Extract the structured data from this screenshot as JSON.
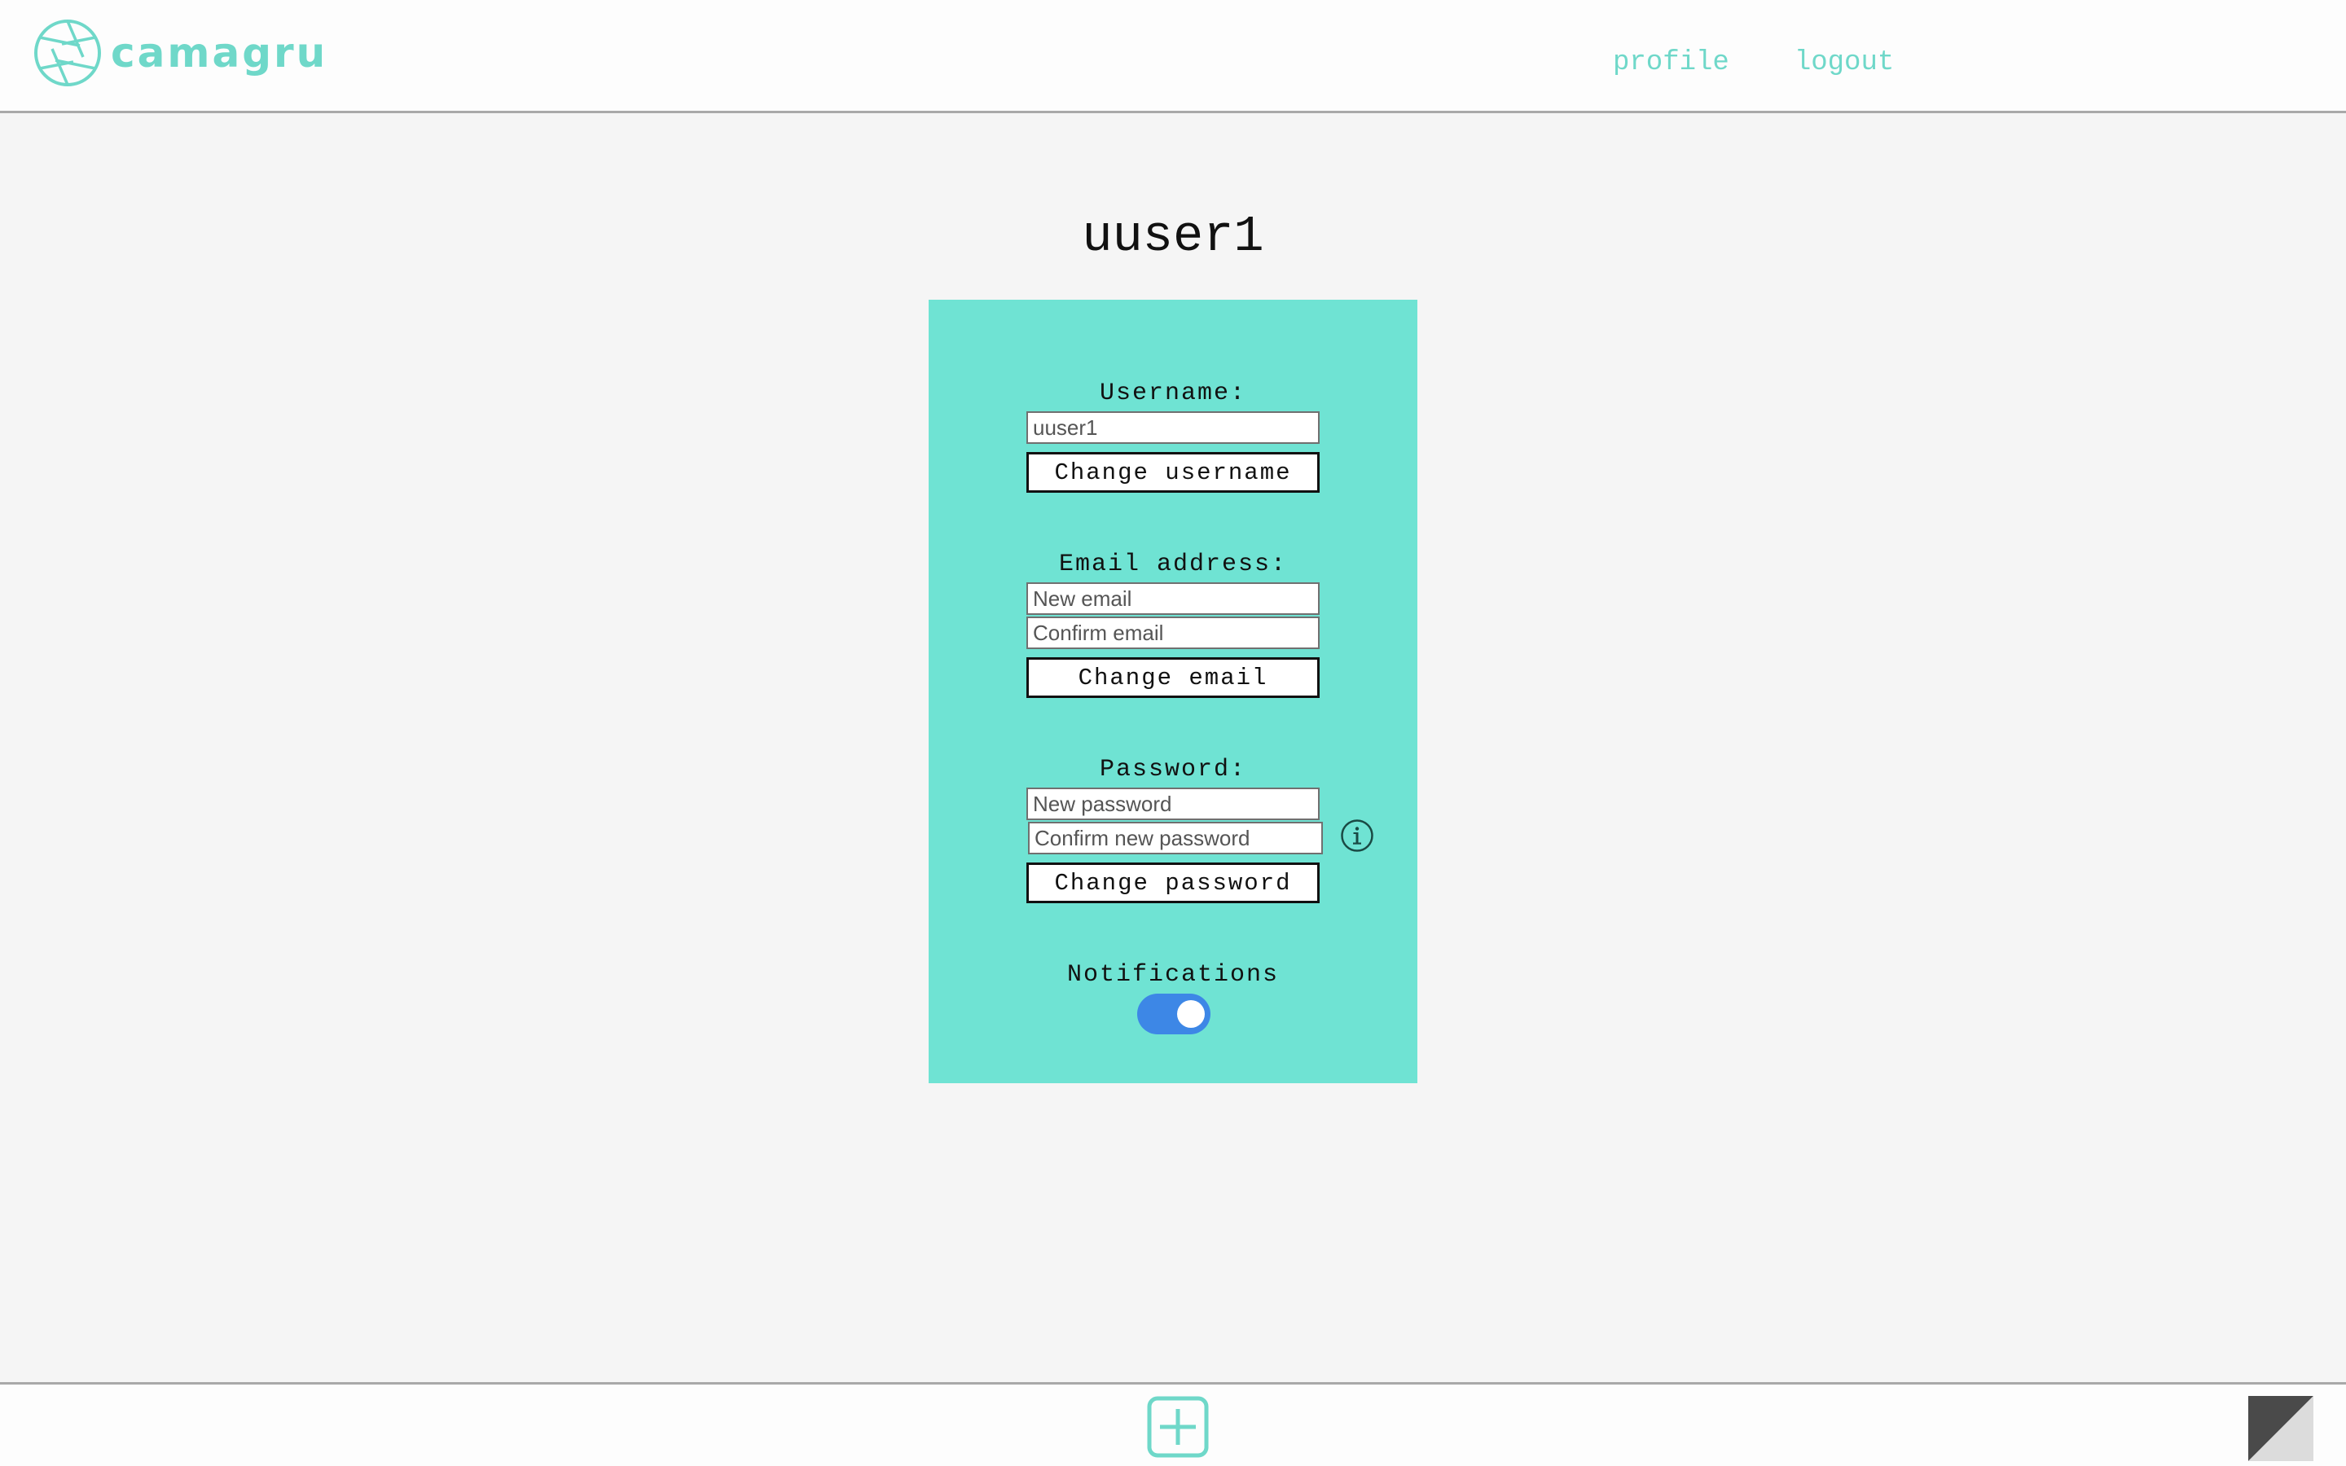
{
  "header": {
    "logo_text": "camagru",
    "nav": {
      "profile_label": "profile",
      "logout_label": "logout"
    }
  },
  "main": {
    "title": "uuser1",
    "username_section": {
      "label": "Username:",
      "input_value": "uuser1",
      "button_label": "Change username"
    },
    "email_section": {
      "label": "Email address:",
      "new_email_placeholder": "New email",
      "confirm_email_placeholder": "Confirm email",
      "button_label": "Change email"
    },
    "password_section": {
      "label": "Password:",
      "new_password_placeholder": "New password",
      "confirm_password_placeholder": "Confirm new password",
      "button_label": "Change password",
      "info_icon": "info-icon"
    },
    "notifications_section": {
      "label": "Notifications",
      "enabled": true
    }
  },
  "footer": {
    "add_icon": "plus-square-icon",
    "theme_icon": "theme-toggle-icon"
  },
  "colors": {
    "accent": "#6fd8c9",
    "card_background": "#6fe3d3",
    "toggle_on": "#3d87e6",
    "page_background": "#f5f5f5"
  }
}
